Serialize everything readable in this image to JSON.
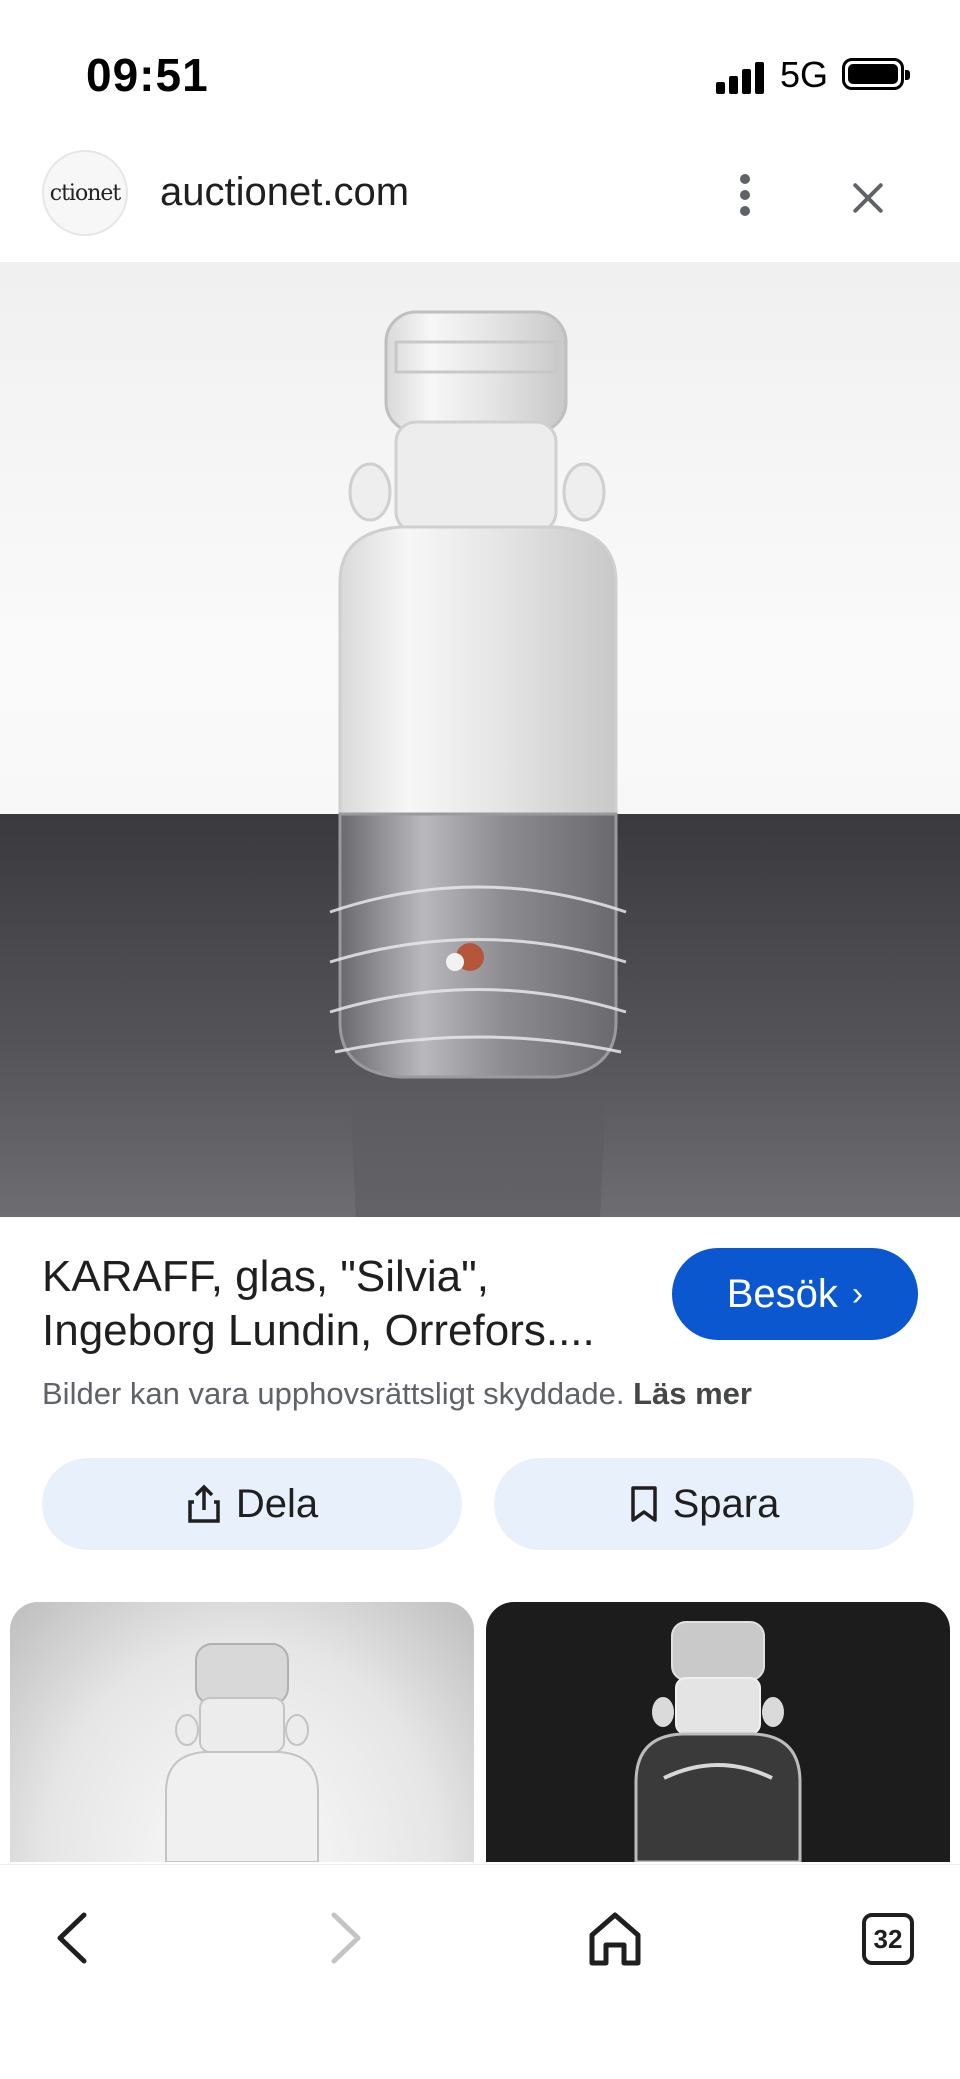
{
  "status_bar": {
    "time": "09:51",
    "network": "5G",
    "signal_icon": "cellular-signal-icon",
    "battery_icon": "battery-icon"
  },
  "header": {
    "logo_text": "ctionet",
    "domain": "auctionet.com",
    "more_icon": "more-vert-icon",
    "close_icon": "close-icon"
  },
  "result": {
    "title_line1": "KARAFF, glas, \"Silvia\",",
    "title_line2": "Ingeborg Lundin, Orrefors....",
    "visit_label": "Besök",
    "visit_icon": "chevron-right-icon",
    "copyright_text": "Bilder kan vara upphovsrättsligt skyddade.",
    "learn_more": "Läs mer"
  },
  "actions": {
    "share_label": "Dela",
    "share_icon": "share-icon",
    "save_label": "Spara",
    "save_icon": "bookmark-icon"
  },
  "bottom_nav": {
    "back_icon": "back-arrow-icon",
    "forward_icon": "forward-arrow-icon",
    "home_icon": "home-icon",
    "tab_count": "32"
  },
  "colors": {
    "accent": "#0b57d0",
    "action_bg": "#e8f0fc",
    "muted_text": "#5f6368"
  }
}
